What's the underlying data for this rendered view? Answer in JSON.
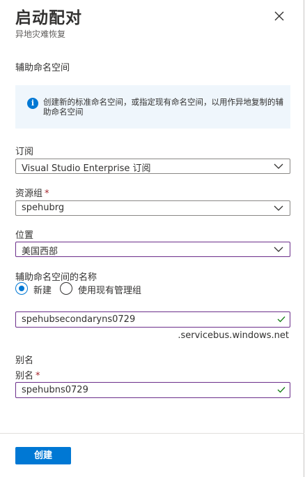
{
  "header": {
    "title": "启动配对",
    "subtitle": "异地灾难恢复"
  },
  "section": {
    "title": "辅助命名空间"
  },
  "info": {
    "text": "创建新的标准命名空间，或指定现有命名空间，以用作异地复制的辅助命名空间"
  },
  "form": {
    "subscription": {
      "label": "订阅",
      "value": "Visual Studio Enterprise 订阅"
    },
    "resource_group": {
      "label": "资源组",
      "required": "*",
      "value": "spehubrg"
    },
    "location": {
      "label": "位置",
      "value": "美国西部"
    },
    "namespace_name": {
      "label": "辅助命名空间的名称",
      "options": {
        "new": "新建",
        "existing": "使用现有管理组"
      },
      "selected": "new",
      "value": "spehubsecondaryns0729",
      "suffix": ".servicebus.windows.net"
    },
    "alias_section": {
      "title": "别名"
    },
    "alias": {
      "label": "别名",
      "required": "*",
      "value": "spehubns0729"
    }
  },
  "footer": {
    "create_label": "创建"
  },
  "colors": {
    "accent": "#0078d4",
    "focus_border": "#6b2e8a",
    "valid_check": "#107c10",
    "info_bg": "#eff6fc"
  }
}
